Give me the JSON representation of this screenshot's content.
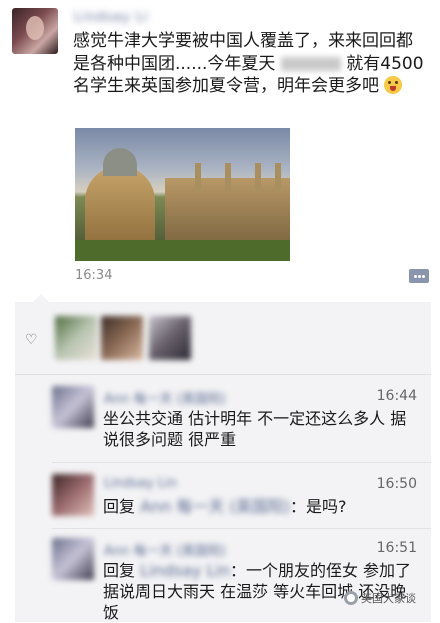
{
  "post": {
    "username": "Lindsay Li",
    "text_before": "感觉牛津大学要被中国人覆盖了，来来回回都是各种中国团......今年夏天",
    "text_after": "就有4500名学生来英国参加夏令营，明年会更多吧",
    "time": "16:34",
    "image_label": "oxford-photo"
  },
  "likes": {
    "icon": "heart-outline-icon"
  },
  "comments": [
    {
      "name": "Ann 每一天 (英国阳)",
      "time": "16:44",
      "text": "坐公共交通 估计明年 不一定还这么多人 据说很多问题 很严重"
    },
    {
      "name": "Lindsay Lin",
      "time": "16:50",
      "reply_prefix": "回复",
      "reply_to": "Ann 每一天 (英国阳)",
      "text": "：是吗?"
    },
    {
      "name": "Ann 每一天 (英国阳)",
      "time": "16:51",
      "reply_prefix": "回复",
      "reply_to": "Lindsay Lin",
      "text": "：一个朋友的侄女 参加了 据说周日大雨天 在温莎 等火车回城 还没晚饭"
    }
  ],
  "watermark": {
    "text": "英国大家谈"
  },
  "colors": {
    "link": "#5b6a91",
    "panel_bg": "#f3f3f5"
  }
}
